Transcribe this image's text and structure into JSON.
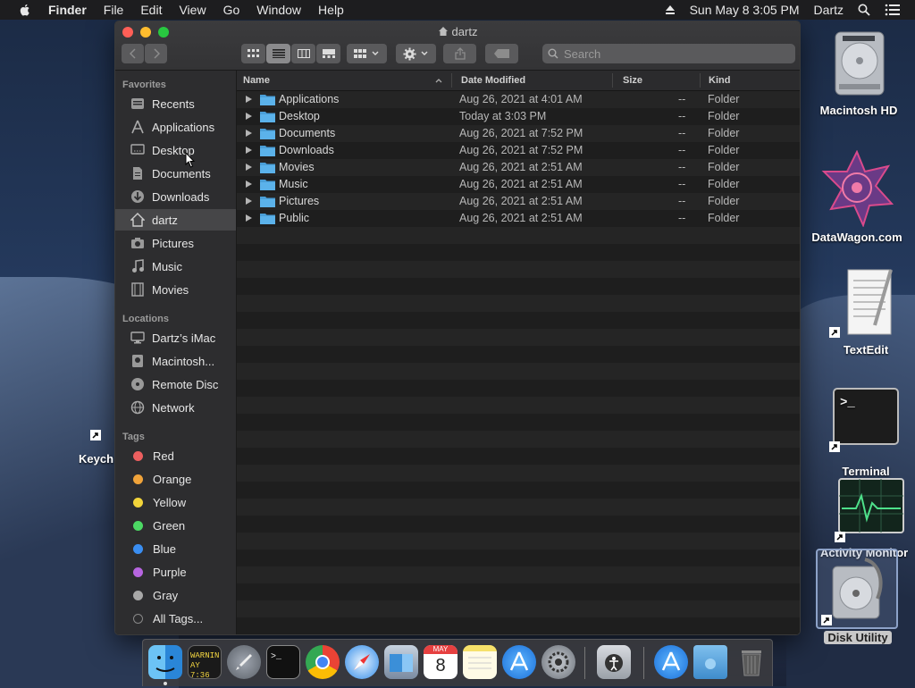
{
  "menubar": {
    "app_name": "Finder",
    "items": [
      "File",
      "Edit",
      "View",
      "Go",
      "Window",
      "Help"
    ],
    "clock": "Sun May 8  3:05 PM",
    "user": "Dartz"
  },
  "window": {
    "title": "dartz",
    "search_placeholder": "Search"
  },
  "sidebar": {
    "favorites_header": "Favorites",
    "favorites": [
      "Recents",
      "Applications",
      "Desktop",
      "Documents",
      "Downloads",
      "dartz",
      "Pictures",
      "Music",
      "Movies"
    ],
    "selected": "dartz",
    "locations_header": "Locations",
    "locations": [
      "Dartz’s iMac",
      "Macintosh...",
      "Remote Disc",
      "Network"
    ],
    "tags_header": "Tags",
    "tags": [
      {
        "label": "Red",
        "color": "#ec5f5f"
      },
      {
        "label": "Orange",
        "color": "#f0a33a"
      },
      {
        "label": "Yellow",
        "color": "#f2d43a"
      },
      {
        "label": "Green",
        "color": "#4cd964"
      },
      {
        "label": "Blue",
        "color": "#3a8ef2"
      },
      {
        "label": "Purple",
        "color": "#b765e0"
      },
      {
        "label": "Gray",
        "color": "#a8a8a8"
      }
    ],
    "all_tags": "All Tags..."
  },
  "list": {
    "columns": {
      "name": "Name",
      "date": "Date Modified",
      "size": "Size",
      "kind": "Kind"
    },
    "rows": [
      {
        "name": "Applications",
        "date": "Aug 26, 2021 at 4:01 AM",
        "size": "--",
        "kind": "Folder"
      },
      {
        "name": "Desktop",
        "date": "Today at 3:03 PM",
        "size": "--",
        "kind": "Folder"
      },
      {
        "name": "Documents",
        "date": "Aug 26, 2021 at 7:52 PM",
        "size": "--",
        "kind": "Folder"
      },
      {
        "name": "Downloads",
        "date": "Aug 26, 2021 at 7:52 PM",
        "size": "--",
        "kind": "Folder"
      },
      {
        "name": "Movies",
        "date": "Aug 26, 2021 at 2:51 AM",
        "size": "--",
        "kind": "Folder"
      },
      {
        "name": "Music",
        "date": "Aug 26, 2021 at 2:51 AM",
        "size": "--",
        "kind": "Folder"
      },
      {
        "name": "Pictures",
        "date": "Aug 26, 2021 at 2:51 AM",
        "size": "--",
        "kind": "Folder"
      },
      {
        "name": "Public",
        "date": "Aug 26, 2021 at 2:51 AM",
        "size": "--",
        "kind": "Folder"
      }
    ]
  },
  "desktop": {
    "icons": [
      "Macintosh HD",
      "DataWagon.com",
      "TextEdit",
      "Terminal",
      "Activity Monitor",
      "Disk Utility"
    ],
    "partial_icon": "Keych"
  },
  "dock": {
    "console_text_1": "WARNIN",
    "console_text_2": "AY 7:36",
    "calendar_month": "MAY",
    "calendar_day": "8"
  },
  "colors": {
    "folder": "#4a9fd8",
    "selection": "#464648",
    "accent_close": "#ff5f57",
    "accent_min": "#febc2e",
    "accent_max": "#28c840"
  }
}
